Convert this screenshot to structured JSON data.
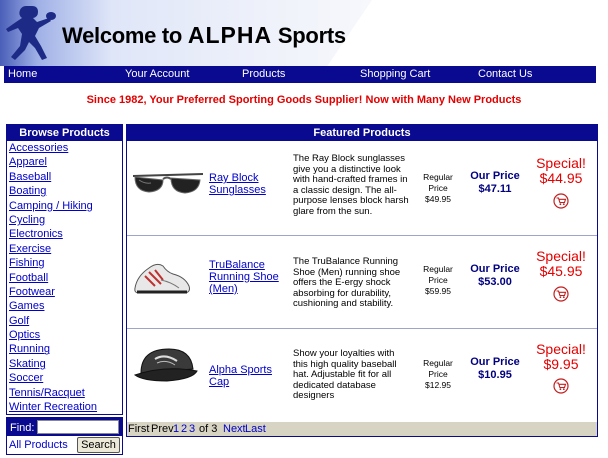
{
  "header": {
    "title_prefix": "Welcome to ",
    "title_brand": "ALPHA",
    "title_suffix": " Sports"
  },
  "nav": [
    {
      "label": "Home"
    },
    {
      "label": "Your Account"
    },
    {
      "label": "Products"
    },
    {
      "label": "Shopping Cart"
    },
    {
      "label": "Contact Us"
    }
  ],
  "tagline": "Since 1982, Your Preferred Sporting Goods Supplier! Now with Many New Products",
  "sidebar": {
    "title": "Browse Products",
    "categories": [
      "Accessories",
      "Apparel",
      "Baseball",
      "Boating",
      "Camping / Hiking",
      "Cycling",
      "Electronics",
      "Exercise",
      "Fishing",
      "Football",
      "Footwear",
      "Games",
      "Golf",
      "Optics",
      "Running",
      "Skating",
      "Soccer",
      "Tennis/Racquet",
      "Winter Recreation"
    ]
  },
  "find": {
    "label": "Find:",
    "input_value": "",
    "scope": "All Products",
    "button_label": "Search"
  },
  "featured": {
    "title": "Featured Products",
    "products": [
      {
        "name": "Ray Block Sunglasses",
        "description": "The Ray Block sunglasses give you a distinctive look with hand-crafted frames in a classic design. The all-purpose lenses block harsh glare from the sun.",
        "regular_label": "Regular Price",
        "regular_price": "$49.95",
        "our_label": "Our Price",
        "our_price": "$47.11",
        "special_label": "Special!",
        "special_price": "$44.95",
        "icon": "add-to-cart-icon"
      },
      {
        "name": "TruBalance Running Shoe (Men)",
        "description": "The TruBalance Running Shoe (Men) running shoe offers the E-ergy shock absorbing for durability, cushioning and stability.",
        "regular_label": "Regular Price",
        "regular_price": "$59.95",
        "our_label": "Our Price",
        "our_price": "$53.00",
        "special_label": "Special!",
        "special_price": "$45.95",
        "icon": "add-to-cart-icon"
      },
      {
        "name": "Alpha Sports Cap",
        "description": "Show your loyalties with this high quality baseball hat. Adjustable fit for all dedicated database designers",
        "regular_label": "Regular Price",
        "regular_price": "$12.95",
        "our_label": "Our Price",
        "our_price": "$10.95",
        "special_label": "Special!",
        "special_price": "$9.95",
        "icon": "add-to-cart-icon"
      }
    ],
    "pager": {
      "first": "First",
      "prev": "Prev",
      "pages": [
        "1",
        "2",
        "3"
      ],
      "of_text": "of 3",
      "next": "Next",
      "last": "Last"
    }
  },
  "colors": {
    "nav_bg": "#0a0a90",
    "accent_red": "#e30000",
    "link_blue": "#0000cc",
    "price_navy": "#000080"
  }
}
